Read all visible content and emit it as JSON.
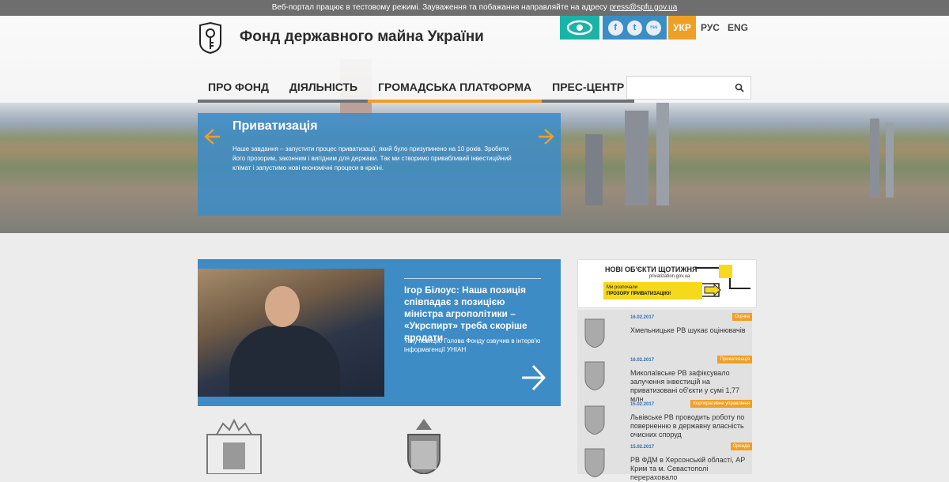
{
  "notice": {
    "text": "Веб-портал працює в тестовому режимі. Зауваження та побажання направляйте на адресу",
    "email": "press@spfu.gov.ua"
  },
  "header": {
    "title": "Фонд державного майна України",
    "logo_icon": "key-emblem-icon"
  },
  "tools": {
    "accessibility_icon": "eye-icon",
    "social": [
      "f",
      "t",
      "rss"
    ]
  },
  "languages": {
    "active": "УКР",
    "ru": "РУС",
    "en": "ENG"
  },
  "nav": {
    "items": [
      {
        "label": "ПРО ФОНД"
      },
      {
        "label": "ДІЯЛЬНІСТЬ"
      },
      {
        "label": "ГРОМАДСЬКА ПЛАТФОРМА"
      },
      {
        "label": "ПРЕС-ЦЕНТР"
      }
    ]
  },
  "search": {
    "value": "",
    "placeholder": ""
  },
  "slide": {
    "title": "Приватизація",
    "text": "Наше завдання – запустити процес приватизації, який було призупинено на 10 років. Зробити його прозорим, законним і вигідним для держави. Так ми створимо привабливий інвестиційний клімат і запустимо нові економічні процеси в країні."
  },
  "feature": {
    "headline": "Ігор Білоус: Наша позиція співпадає з позицією міністра агрополітики – «Укрспирт» треба скоріше продати",
    "desc": "Таку позицію Голова Фонду озвучив в інтерв'ю інформагенції УНІАН"
  },
  "banner": {
    "title": "НОВІ ОБ'ЄКТИ ЩОТИЖНЯ",
    "site": "privatization.gov.ua",
    "line1": "Ми розпочали",
    "line2": "ПРОЗОРУ ПРИВАТИЗАЦІЮ!"
  },
  "news": [
    {
      "date": "16.02.2017",
      "tag": "Оцінка",
      "title": "Хмельницьке РВ шукає оцінювачів"
    },
    {
      "date": "16.02.2017",
      "tag": "Приватизація",
      "title": "Миколаївське РВ зафіксувало залучення інвестицій на приватизовані об'єкти у сумі 1,77 млн"
    },
    {
      "date": "15.02.2017",
      "tag": "Корпоративне управління",
      "title": "Львівське РВ проводить роботу по поверненню в державну власність очисних споруд"
    },
    {
      "date": "15.02.2017",
      "tag": "Оренда",
      "title": "РВ ФДМ в Херсонській області, АР Крим та м. Севастополі перераховало"
    }
  ],
  "colors": {
    "accent": "#ef9f24",
    "blue": "#3e8cc6",
    "teal": "#1bb3a8"
  }
}
